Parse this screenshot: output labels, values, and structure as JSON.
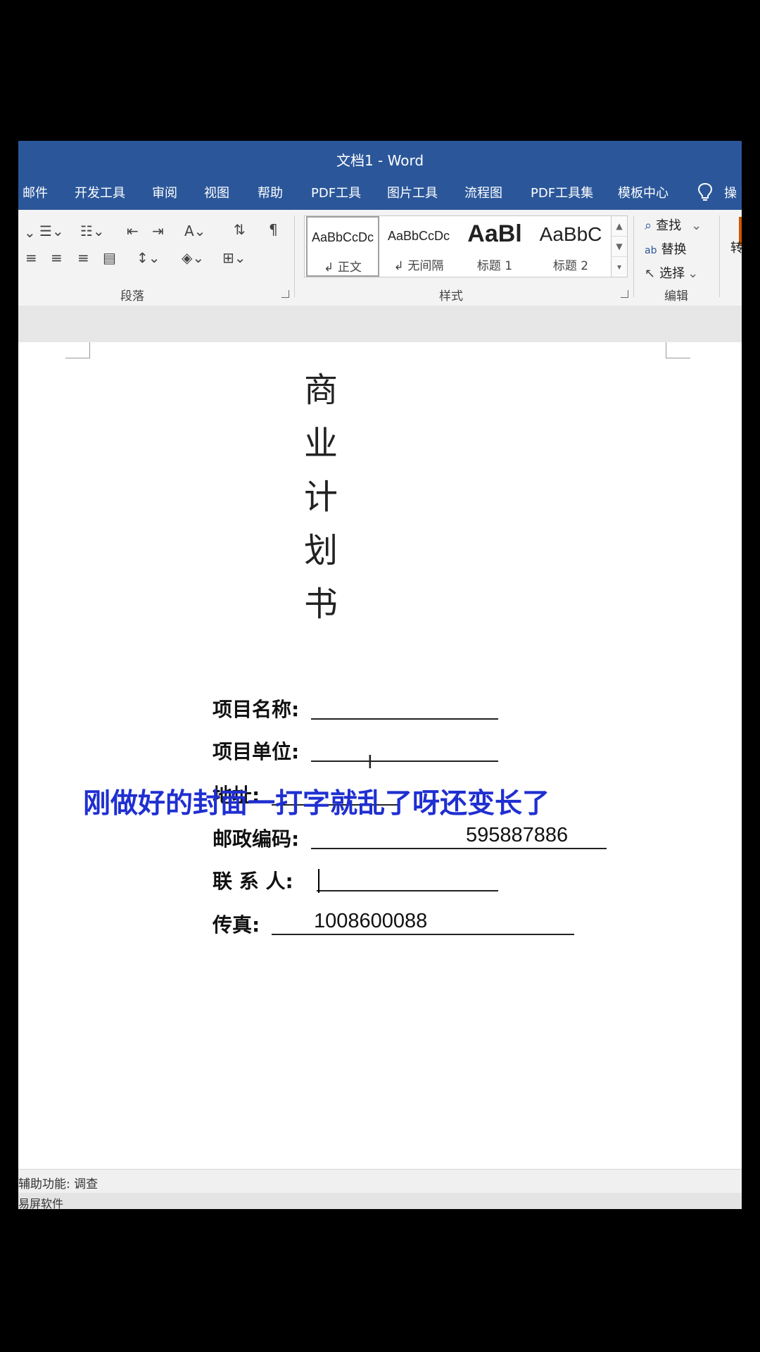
{
  "window": {
    "title": "文档1  -  Word"
  },
  "tabs": [
    "邮件",
    "开发工具",
    "审阅",
    "视图",
    "帮助",
    "PDF工具",
    "图片工具",
    "流程图",
    "PDF工具集",
    "模板中心"
  ],
  "tab_cut": "操",
  "ribbon": {
    "paragraph_group": "段落",
    "styles_group": "样式",
    "editing_group": "编辑",
    "styles": [
      {
        "sample": "AaBbCcDc",
        "label": "↲ 正文"
      },
      {
        "sample": "AaBbCcDc",
        "label": "↲ 无间隔"
      },
      {
        "sample": "AaBl",
        "label": "标题 1"
      },
      {
        "sample": "AaBbC",
        "label": "标题 2"
      }
    ],
    "edit": {
      "find": "查找",
      "replace": "替换",
      "select": "选择"
    },
    "right_cut": "转"
  },
  "document": {
    "title_chars": [
      "商",
      "业",
      "计",
      "划",
      "书"
    ],
    "fields": {
      "project_name": "项目名称:",
      "project_unit": "项目单位:",
      "address": "地址:",
      "postcode_label": "邮政编码:",
      "postcode_value": "595887886",
      "contact": "联  系  人:",
      "fax_label": "传真:",
      "fax_value": "1008600088"
    }
  },
  "caption": "刚做好的封面一打字就乱了呀还变长了",
  "status": {
    "accessibility": "辅助功能: 调查",
    "taskbar_cut": "易屏软件"
  },
  "colors": {
    "accent": "#2b579a",
    "caption": "#1f2fd1"
  }
}
